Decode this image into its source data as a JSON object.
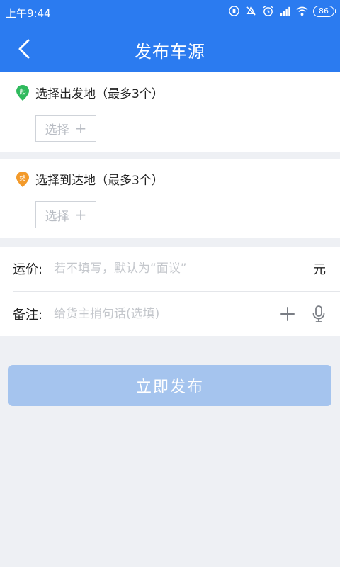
{
  "status_bar": {
    "time": "上午9:44",
    "battery": "86",
    "icons": [
      "hd-icon",
      "mute-icon",
      "alarm-icon",
      "signal-icon",
      "wifi-icon",
      "battery-icon"
    ]
  },
  "header": {
    "title": "发布车源",
    "color": "#2b7bf0"
  },
  "origin": {
    "badge": "起",
    "badge_color": "#2fba5d",
    "label": "选择出发地（最多3个）",
    "select_label": "选择"
  },
  "destination": {
    "badge": "终",
    "badge_color": "#f39a2a",
    "label": "选择到达地（最多3个）",
    "select_label": "选择"
  },
  "freight": {
    "label": "运价:",
    "placeholder": "若不填写，默认为“面议”",
    "unit": "元"
  },
  "remark": {
    "label": "备注:",
    "placeholder": "给货主捎句话(选填)"
  },
  "publish_button": {
    "label": "立即发布",
    "color": "#a5c4ee"
  }
}
